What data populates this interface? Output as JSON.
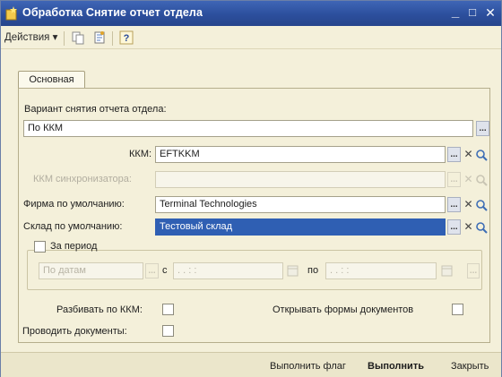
{
  "window": {
    "title": "Обработка  Снятие отчет отдела",
    "minimize": "_",
    "maximize": "□",
    "close": "✕"
  },
  "toolbar": {
    "actions_label": "Действия",
    "actions_arrow": "▾",
    "help_label": "?"
  },
  "tabs": [
    {
      "label": "Основная"
    }
  ],
  "form": {
    "variant_label": "Вариант снятия отчета отдела:",
    "variant_value": "По ККМ",
    "kkm_label": "ККМ:",
    "kkm_value": "EFTKKM",
    "sync_kkm_label": "ККМ синхронизатора:",
    "sync_kkm_value": "",
    "firm_label": "Фирма по умолчанию:",
    "firm_value": "Terminal Technologies",
    "warehouse_label": "Склад по умолчанию:",
    "warehouse_value": "Тестовый склад",
    "period_label": "За период",
    "period_mode_value": "По датам",
    "from_label": "с",
    "from_value": ".  .    :  :",
    "to_label": "по",
    "to_value": ".  .    :  :",
    "split_kkm_label": "Разбивать по ККМ:",
    "post_docs_label": "Проводить документы:",
    "open_forms_label": "Открывать формы документов"
  },
  "buttons": {
    "flag_label": "Выполнить флаг",
    "execute_label": "Выполнить",
    "close_label": "Закрыть"
  },
  "icons": {
    "select": "...",
    "clear": "✕",
    "open": "search-icon"
  },
  "colors": {
    "titlebar": "#2c4f9d",
    "selection": "#2f5fb3",
    "background": "#f4f0da"
  }
}
